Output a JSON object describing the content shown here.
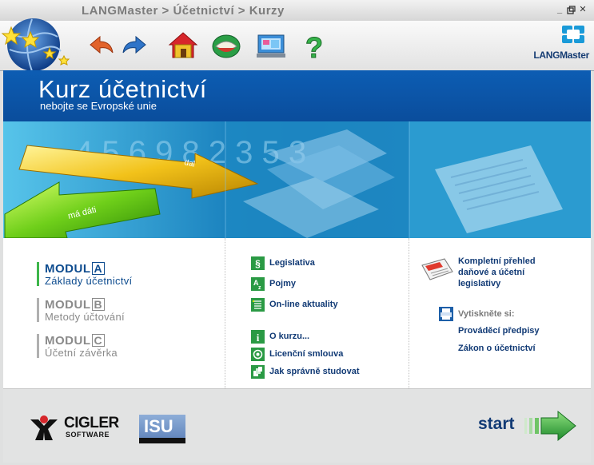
{
  "window": {
    "title": "LANGMaster > Účetnictví > Kurzy",
    "buttons": [
      "minimize-icon",
      "restore-icon",
      "close-icon"
    ]
  },
  "toolbar": {
    "icons": [
      "back-arrow-icon",
      "forward-arrow-icon",
      "home-icon",
      "book-icon",
      "computer-icon",
      "help-icon"
    ],
    "brand": "LANGMaster"
  },
  "header": {
    "title": "Kurz účetnictví",
    "subtitle": "nebojte se Evropské unie"
  },
  "banner": {
    "arrow_right_label": "dal",
    "arrow_left_label": "má dáti",
    "digits": "4 5 6 9 8 2 3 5 3"
  },
  "modules": [
    {
      "word": "MODUL",
      "letter": "A",
      "name": "Základy účetnictví",
      "active": true
    },
    {
      "word": "MODUL",
      "letter": "B",
      "name": "Metody účtování",
      "active": false
    },
    {
      "word": "MODUL",
      "letter": "C",
      "name": "Účetní závěrka",
      "active": false
    }
  ],
  "links_top": [
    {
      "label": "Legislativa",
      "icon": "paragraph-icon"
    },
    {
      "label": "Pojmy",
      "icon": "dictionary-icon"
    },
    {
      "label": "On-line aktuality",
      "icon": "news-icon"
    }
  ],
  "links_bottom": [
    {
      "label": "O kurzu...",
      "icon": "info-icon"
    },
    {
      "label": "Licenční smlouva",
      "icon": "license-icon"
    },
    {
      "label": "Jak správně studovat",
      "icon": "study-icon"
    }
  ],
  "right_panel": {
    "overview": "Kompletní přehled daňové a účetní legislativy",
    "overview_lines": [
      "Kompletní přehled",
      "daňové a účetní",
      "legislativy"
    ],
    "print_heading": "Vytiskněte si:",
    "print_links": [
      "Prováděcí předpisy",
      "Zákon o účetnictví"
    ]
  },
  "footer": {
    "logo1_main": "CIGLER",
    "logo1_sub": "SOFTWARE",
    "logo2_main": "ISU",
    "start_label": "start"
  },
  "colors": {
    "header_blue": "#0b56a8",
    "link_blue": "#113a75",
    "active_module": "#0e4c8f",
    "inactive_module": "#8a8a8a",
    "accent_green": "#33b24a"
  }
}
